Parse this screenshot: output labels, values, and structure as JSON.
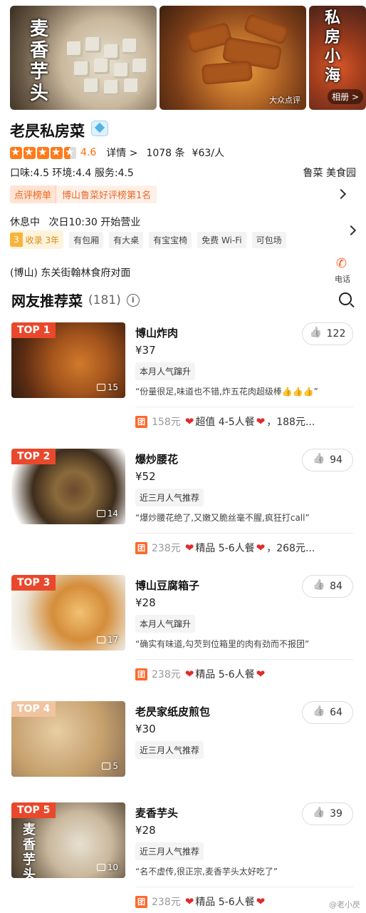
{
  "gallery": {
    "photo1_text": "麦香芋头",
    "photo2_watermark": "大众点评",
    "photo3_text": "私房小海",
    "album_label": "相册 >"
  },
  "shop": {
    "name": "老昃私房菜",
    "rating_stars": 4.5,
    "score": "4.6",
    "detail_label": "详情 >",
    "reviews": "1078 条",
    "avg_price": "¥63/人",
    "sub_scores": "口味:4.5  环境:4.4  服务:4.5",
    "category": "鲁菜  美食园",
    "rank_tag": "点评榜单",
    "rank_text": "博山鲁菜好评榜第1名",
    "status": "休息中",
    "open_time": "次日10:30 开始营业",
    "collect_num": "3",
    "collect_label": "收录 3年",
    "facility_tags": [
      "有包厢",
      "有大桌",
      "有宝宝椅",
      "免费 Wi-Fi",
      "可包场"
    ],
    "address": "(博山) 东关街翰林食府对面",
    "phone_label": "电话"
  },
  "recommend": {
    "title": "网友推荐菜",
    "count": "(181)",
    "info_symbol": "i"
  },
  "dishes": [
    {
      "rank": "TOP 1",
      "name": "博山炸肉",
      "price": "¥37",
      "tag": "本月人气蹿升",
      "quote": "“份量很足,味道也不错,炸五花肉超级棒👍👍👍”",
      "img_count": "15",
      "likes": "122",
      "deal_price": "158元",
      "deal_text": "超值 4-5人餐",
      "deal_more": "，188元..."
    },
    {
      "rank": "TOP 2",
      "name": "爆炒腰花",
      "price": "¥52",
      "tag": "近三月人气推荐",
      "quote": "“爆炒腰花绝了,又嫩又脆丝毫不腥,疯狂打call”",
      "img_count": "14",
      "likes": "94",
      "deal_price": "238元",
      "deal_text": "精品 5-6人餐",
      "deal_more": "，268元..."
    },
    {
      "rank": "TOP 3",
      "name": "博山豆腐箱子",
      "price": "¥28",
      "tag": "本月人气蹿升",
      "quote": "“确实有味道,勾芡到位箱里的肉有劲而不报团”",
      "img_count": "17",
      "likes": "84",
      "deal_price": "238元",
      "deal_text": "精品 5-6人餐",
      "deal_more": ""
    },
    {
      "rank": "TOP 4",
      "name": "老昃家纸皮煎包",
      "price": "¥30",
      "tag": "近三月人气推荐",
      "quote": "",
      "img_count": "5",
      "likes": "64",
      "deal_price": "",
      "deal_text": "",
      "deal_more": ""
    },
    {
      "rank": "TOP 5",
      "name": "麦香芋头",
      "price": "¥28",
      "tag": "近三月人气推荐",
      "quote": "“名不虚传,很正宗,麦香芋头太好吃了”",
      "img_count": "10",
      "likes": "39",
      "deal_price": "238元",
      "deal_text": "精品 5-6人餐",
      "deal_more": "",
      "img_text": "麦香芋头"
    }
  ],
  "tuan_label": "团",
  "weibo_mark": "@老小昃"
}
